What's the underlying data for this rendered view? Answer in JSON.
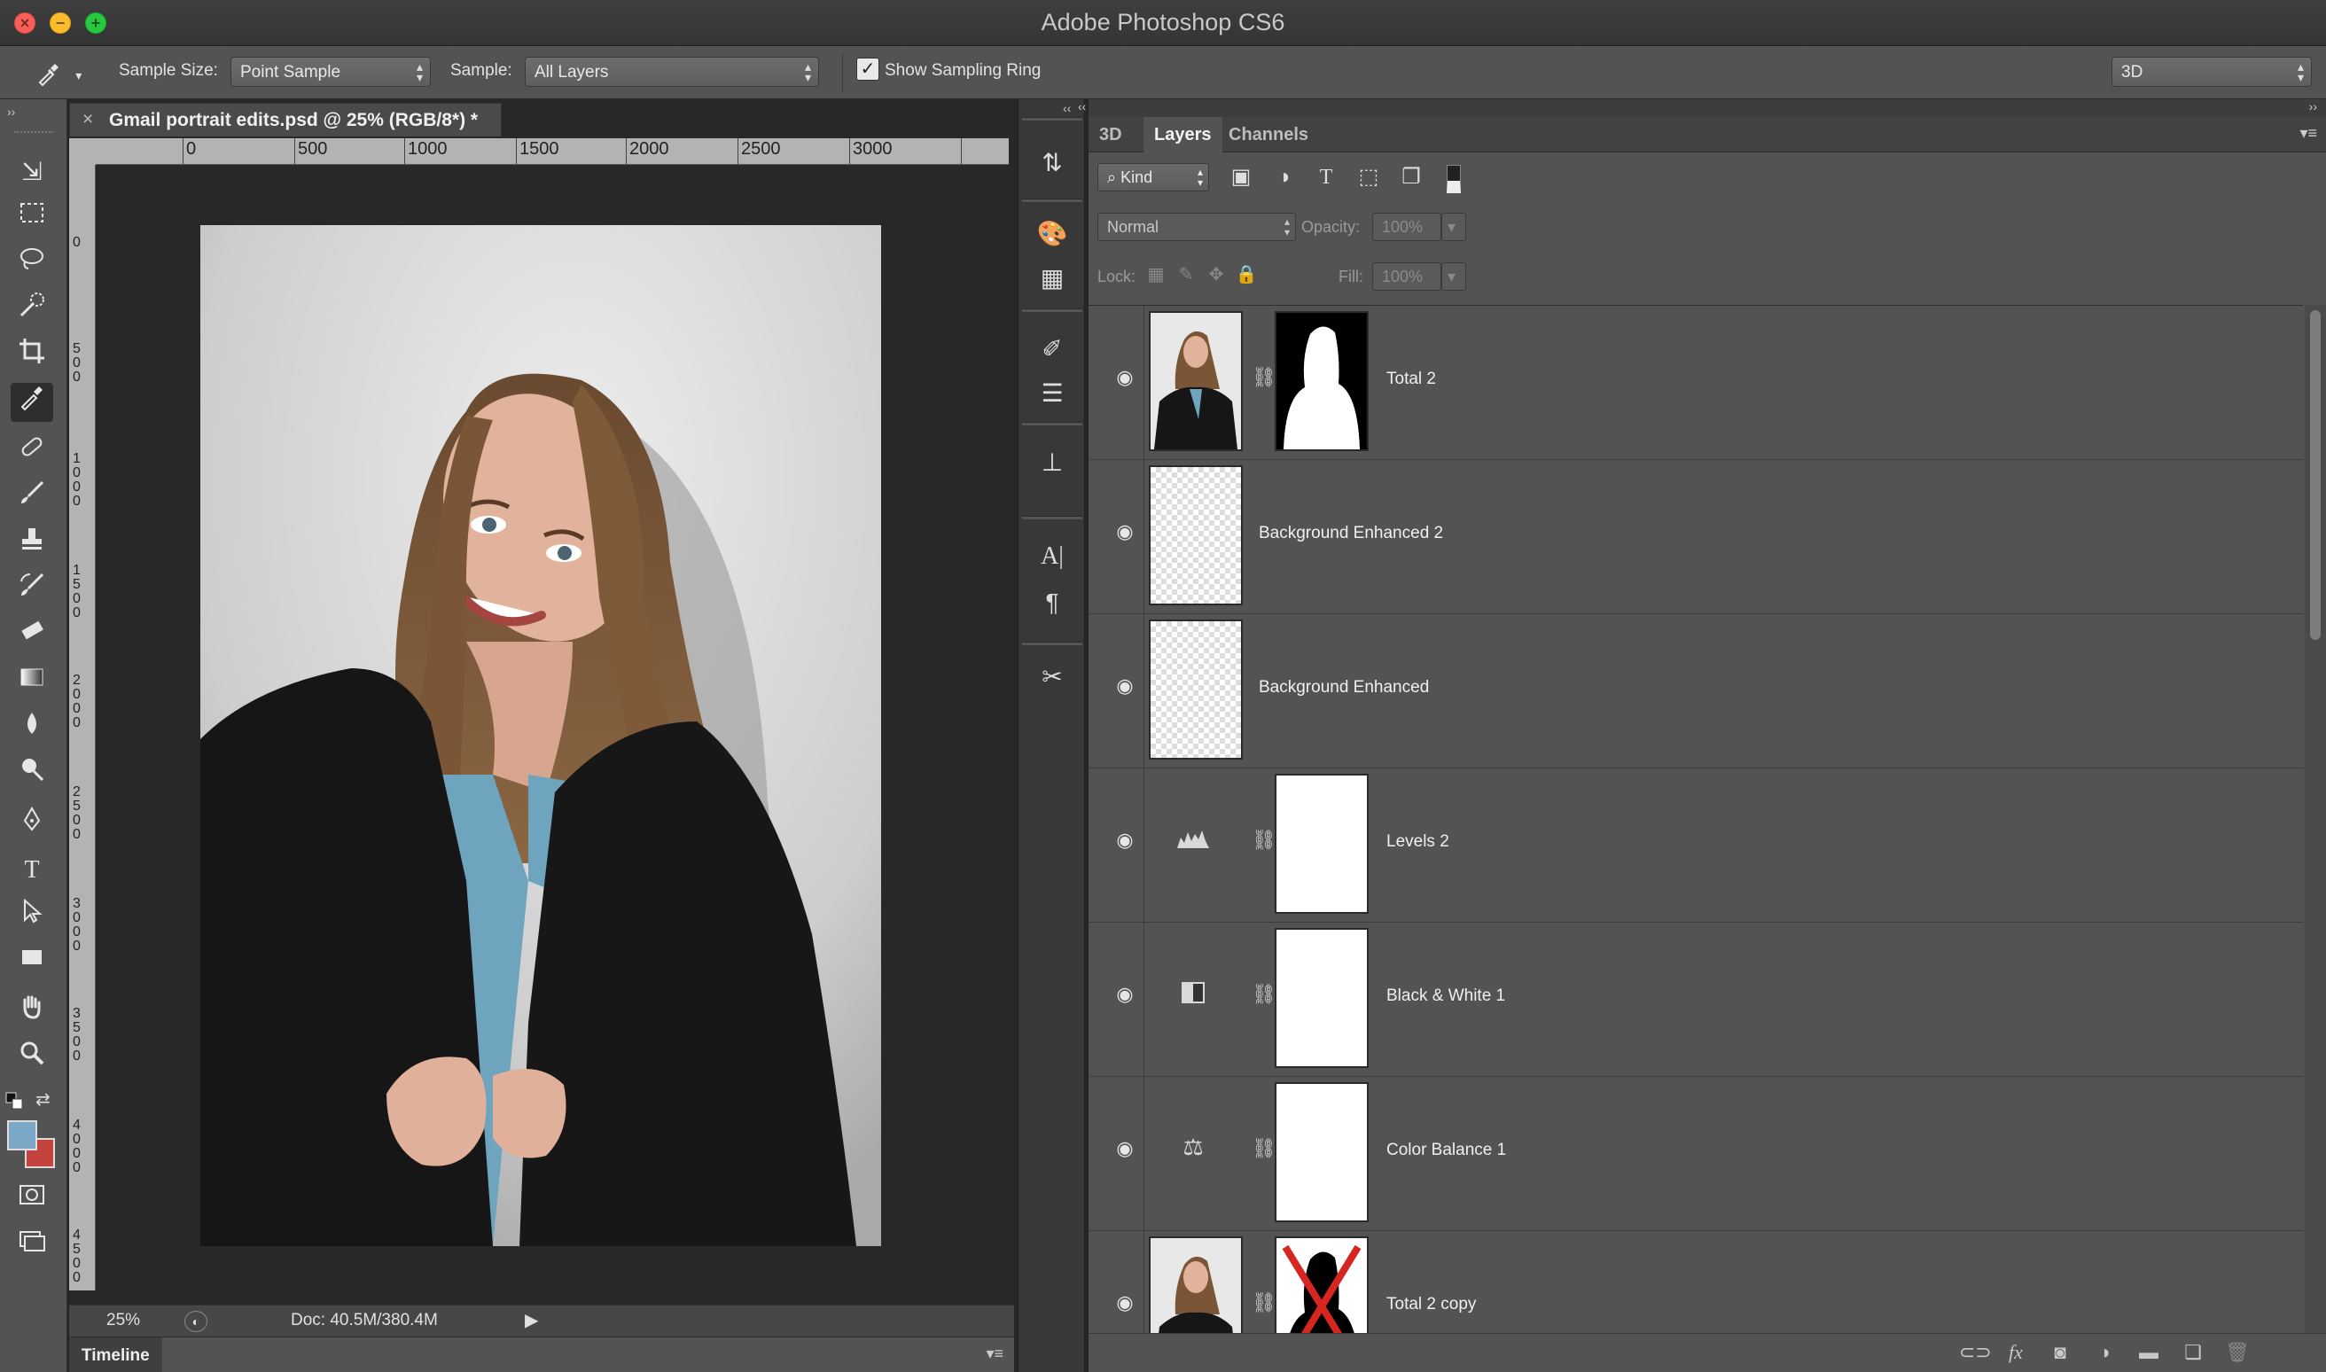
{
  "window": {
    "title": "Adobe Photoshop CS6"
  },
  "options_bar": {
    "sample_size_label": "Sample Size:",
    "sample_size_value": "Point Sample",
    "sample_label": "Sample:",
    "sample_value": "All Layers",
    "show_sampling_ring_label": "Show Sampling Ring",
    "show_sampling_ring_checked": true,
    "workspace_value": "3D"
  },
  "document": {
    "tab_title": "Gmail portrait edits.psd @ 25% (RGB/8*) *",
    "ruler_h_labels": [
      "0",
      "500",
      "1000",
      "1500",
      "2000",
      "2500",
      "3000"
    ],
    "ruler_v_labels": [
      "0",
      "500",
      "1000",
      "1500",
      "2000",
      "2500",
      "3000",
      "3500",
      "4000",
      "4500"
    ],
    "zoom": "25%",
    "doc_size": "Doc: 40.5M/380.4M"
  },
  "timeline": {
    "label": "Timeline"
  },
  "layers_panel": {
    "tabs": [
      "3D",
      "Layers",
      "Channels"
    ],
    "active_tab": "Layers",
    "filter_kind": "Kind",
    "blend_mode": "Normal",
    "opacity_label": "Opacity:",
    "opacity_value": "100%",
    "lock_label": "Lock:",
    "fill_label": "Fill:",
    "fill_value": "100%",
    "layers": [
      {
        "name": "Total 2",
        "kind": "pixel-mask"
      },
      {
        "name": "Background Enhanced 2",
        "kind": "transparent"
      },
      {
        "name": "Background Enhanced",
        "kind": "transparent"
      },
      {
        "name": "Levels 2",
        "kind": "levels-adjustment",
        "icon": "levels-icon"
      },
      {
        "name": "Black & White 1",
        "kind": "bw-adjustment",
        "icon": "black-white-icon"
      },
      {
        "name": "Color Balance 1",
        "kind": "color-balance-adjustment",
        "icon": "scale-icon"
      },
      {
        "name": "Total 2 copy",
        "kind": "pixel-mask-x"
      }
    ]
  },
  "colors": {
    "foreground": "#7aa8c6",
    "background": "#c5433e",
    "panel_bg": "#535353"
  }
}
